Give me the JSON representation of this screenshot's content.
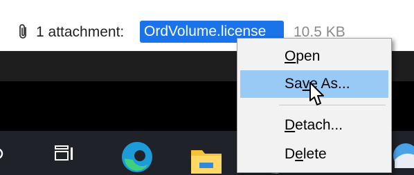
{
  "attachment_bar": {
    "count_label": "1 attachment:",
    "file_name": "OrdVolume.license",
    "file_size": "10.5 KB"
  },
  "context_menu": {
    "items": [
      {
        "pre": "",
        "key": "O",
        "post": "pen"
      },
      {
        "pre": "Sa",
        "key": "v",
        "post": "e As..."
      },
      {
        "pre": "",
        "key": "D",
        "post": "etach..."
      },
      {
        "pre": "D",
        "key": "e",
        "post": "lete"
      }
    ],
    "hovered_item": "Save As..."
  },
  "taskbar": {
    "icons": [
      "search-icon",
      "task-view-icon",
      "edge-icon",
      "file-explorer-icon",
      "chrome-icon",
      "app-icon"
    ]
  },
  "colors": {
    "selection_blue": "#1a73e8",
    "menu_hover": "#99c9f5",
    "taskbar": "#1f2329"
  }
}
